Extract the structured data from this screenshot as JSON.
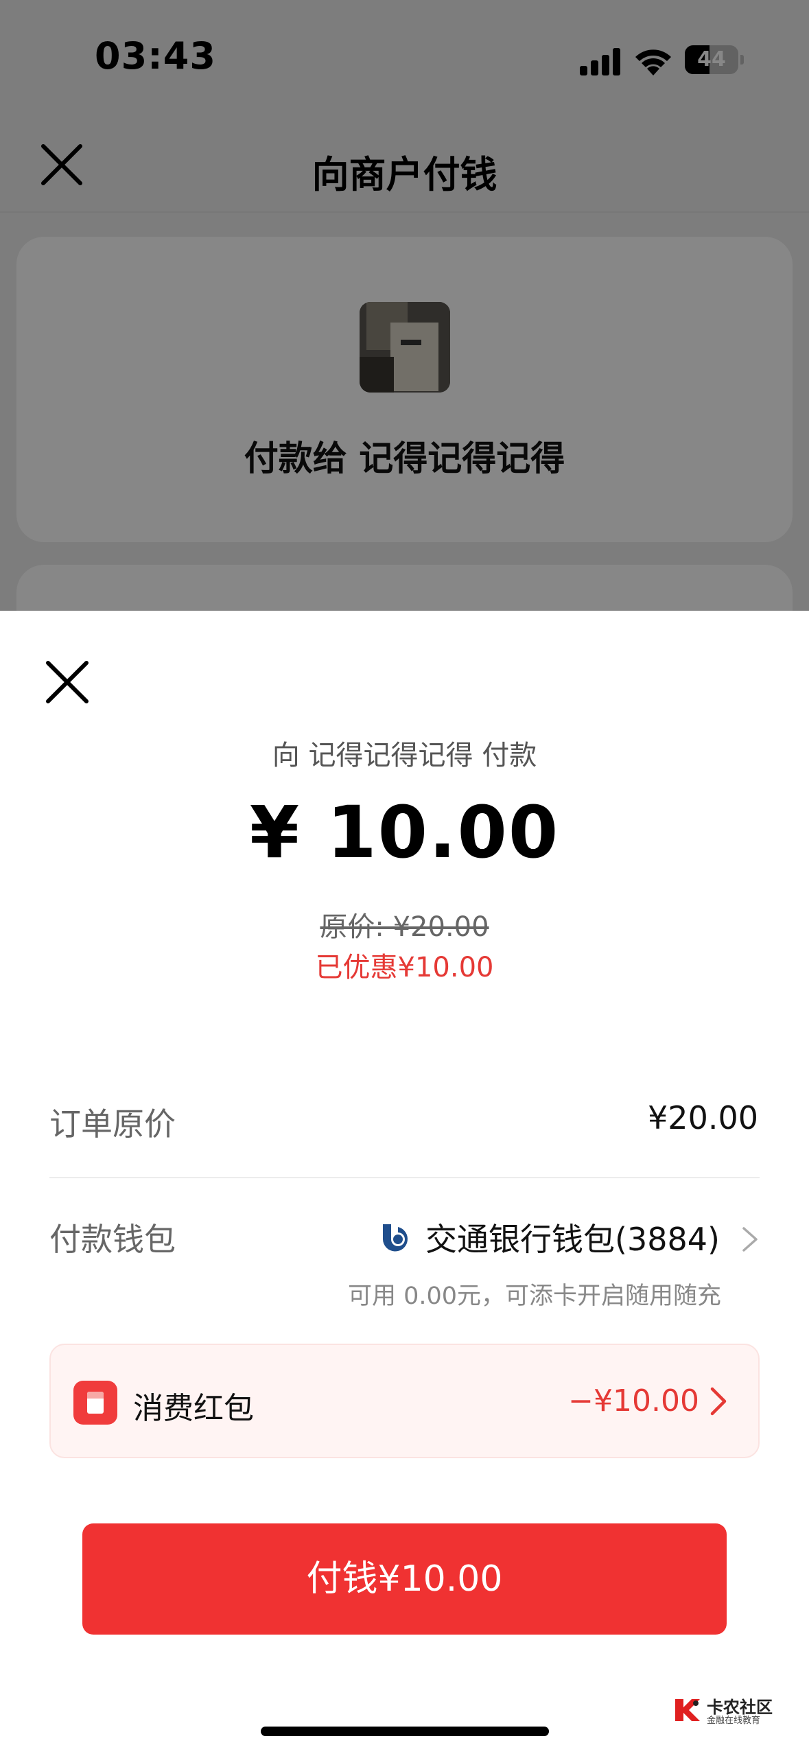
{
  "status_bar": {
    "time": "03:43",
    "battery": "44",
    "icons": [
      "signal-icon",
      "wifi-icon",
      "battery-icon"
    ]
  },
  "nav": {
    "title": "向商户付钱",
    "close_icon": "close-icon"
  },
  "merchant": {
    "name_line": "付款给 记得记得记得"
  },
  "sheet": {
    "payee_line": "向 记得记得记得 付款",
    "amount": "¥ 10.00",
    "original_price": "原价: ¥20.00",
    "discount": "已优惠¥10.00",
    "order_price_label": "订单原价",
    "order_price_value": "¥20.00",
    "wallet_label": "付款钱包",
    "wallet_value": "交通银行钱包(3884)",
    "wallet_hint": "可用 0.00元，可添卡开启随用随充",
    "coupon_label": "消费红包",
    "coupon_value": "−¥10.00",
    "pay_button": "付钱¥10.00"
  },
  "watermark": {
    "title": "卡农社区",
    "subtitle": "金融在线教育"
  },
  "colors": {
    "accent_red": "#f03232",
    "discount_red": "#e53935",
    "bank_blue": "#1f4e8c"
  }
}
